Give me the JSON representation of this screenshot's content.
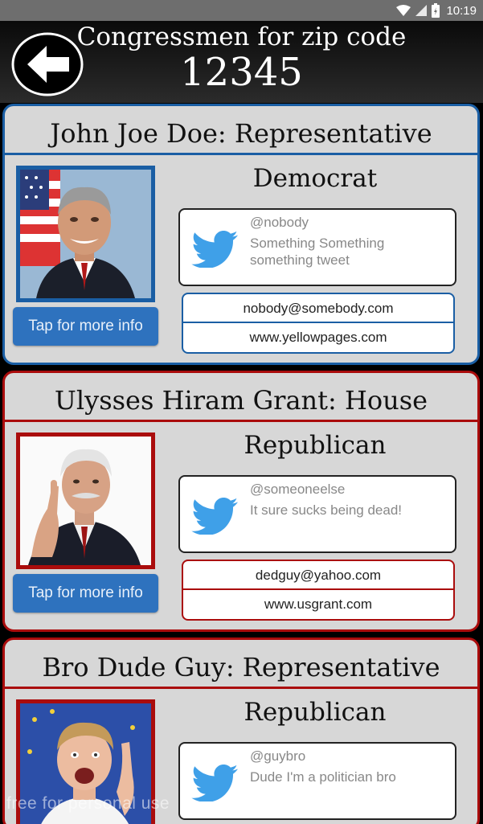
{
  "status_bar": {
    "time": "10:19",
    "icons": [
      "wifi-icon",
      "signal-icon",
      "battery-icon"
    ]
  },
  "header": {
    "title_line1": "Congressmen for zip code",
    "title_line2": "12345",
    "back_icon": "arrow-left-icon"
  },
  "colors": {
    "democrat": "#1a5ea4",
    "republican": "#aa0c0c",
    "button": "#2e72be",
    "twitter": "#3fa0e8"
  },
  "cards": [
    {
      "title": "John Joe Doe: Representative",
      "party": "Democrat",
      "more_info_label": "Tap for more info",
      "tweet": {
        "handle": "@nobody",
        "text": "Something Something something tweet"
      },
      "email": "nobody@somebody.com",
      "website": "www.yellowpages.com"
    },
    {
      "title": "Ulysses Hiram Grant: House",
      "party": "Republican",
      "more_info_label": "Tap for more info",
      "tweet": {
        "handle": "@someoneelse",
        "text": "It sure sucks being dead!"
      },
      "email": "dedguy@yahoo.com",
      "website": "www.usgrant.com"
    },
    {
      "title": "Bro Dude Guy: Representative",
      "party": "Republican",
      "tweet": {
        "handle": "@guybro",
        "text": "Dude I'm a politician bro"
      }
    }
  ],
  "watermark": "free for personal use"
}
